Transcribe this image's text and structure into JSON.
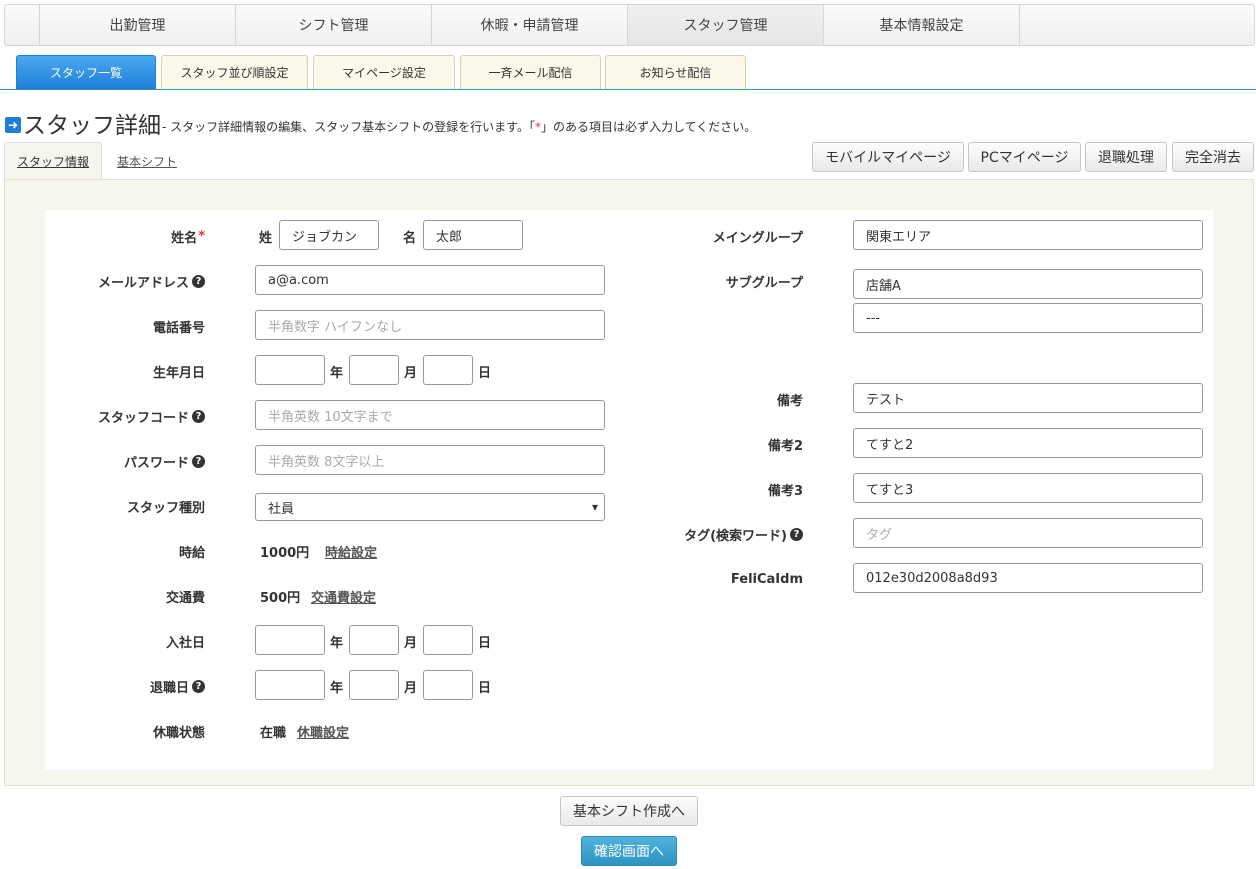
{
  "top_nav": {
    "tabs": [
      {
        "label": "出勤管理"
      },
      {
        "label": "シフト管理"
      },
      {
        "label": "休暇・申請管理"
      },
      {
        "label": "スタッフ管理"
      },
      {
        "label": "基本情報設定"
      }
    ]
  },
  "sub_nav": {
    "tabs": [
      {
        "label": "スタッフ一覧"
      },
      {
        "label": "スタッフ並び順設定"
      },
      {
        "label": "マイページ設定"
      },
      {
        "label": "一斉メール配信"
      },
      {
        "label": "お知らせ配信"
      }
    ]
  },
  "header": {
    "title": "スタッフ詳細",
    "desc_before": "- スタッフ詳細情報の編集、スタッフ基本シフトの登録を行います。「",
    "required_mark": "*",
    "desc_after": "」のある項目は必ず入力してください。"
  },
  "detail_tabs": [
    {
      "label": "スタッフ情報"
    },
    {
      "label": "基本シフト"
    }
  ],
  "actions": {
    "mobile": "モバイルマイページ",
    "pc": "PCマイページ",
    "retire": "退職処理",
    "delete": "完全消去"
  },
  "form": {
    "name_label": "姓名",
    "required_mark": "*",
    "sei_label": "姓",
    "sei_value": "ジョブカン",
    "mei_label": "名",
    "mei_value": "太郎",
    "email_label": "メールアドレス",
    "email_value": "a@a.com",
    "phone_label": "電話番号",
    "phone_placeholder": "半角数字 ハイフンなし",
    "birth_label": "生年月日",
    "year_unit": "年",
    "month_unit": "月",
    "day_unit": "日",
    "staff_code_label": "スタッフコード",
    "staff_code_placeholder": "半角英数 10文字まで",
    "password_label": "パスワード",
    "password_placeholder": "半角英数 8文字以上",
    "staff_type_label": "スタッフ種別",
    "staff_type_value": "社員",
    "hourly_label": "時給",
    "hourly_value": "1000円",
    "hourly_link": "時給設定",
    "transport_label": "交通費",
    "transport_value": "500円",
    "transport_link": "交通費設定",
    "join_label": "入社日",
    "leave_label": "退職日",
    "status_label": "休職状態",
    "status_value": "在職",
    "status_link": "休職設定",
    "main_group_label": "メイングループ",
    "main_group_value": "関東エリア",
    "sub_group_label": "サブグループ",
    "sub_group_value1": "店舗A",
    "sub_group_value2": "---",
    "note_label": "備考",
    "note_value": "テスト",
    "note2_label": "備考2",
    "note2_value": "てすと2",
    "note3_label": "備考3",
    "note3_value": "てすと3",
    "tag_label": "タグ(検索ワード)",
    "tag_placeholder": "タグ",
    "felica_label": "FeliCaIdm",
    "felica_value": "012e30d2008a8d93"
  },
  "bottom": {
    "create_shift": "基本シフト作成へ",
    "confirm": "確認画面へ"
  },
  "icons": {
    "heading": "arrow-right-icon",
    "help": "question-circle-icon",
    "select": "caret-down-icon"
  },
  "colors": {
    "accent_blue": "#1f7fd8",
    "panel_bg": "#f7f6ee",
    "required": "#e33333",
    "confirm_btn": "#2f93c2"
  }
}
